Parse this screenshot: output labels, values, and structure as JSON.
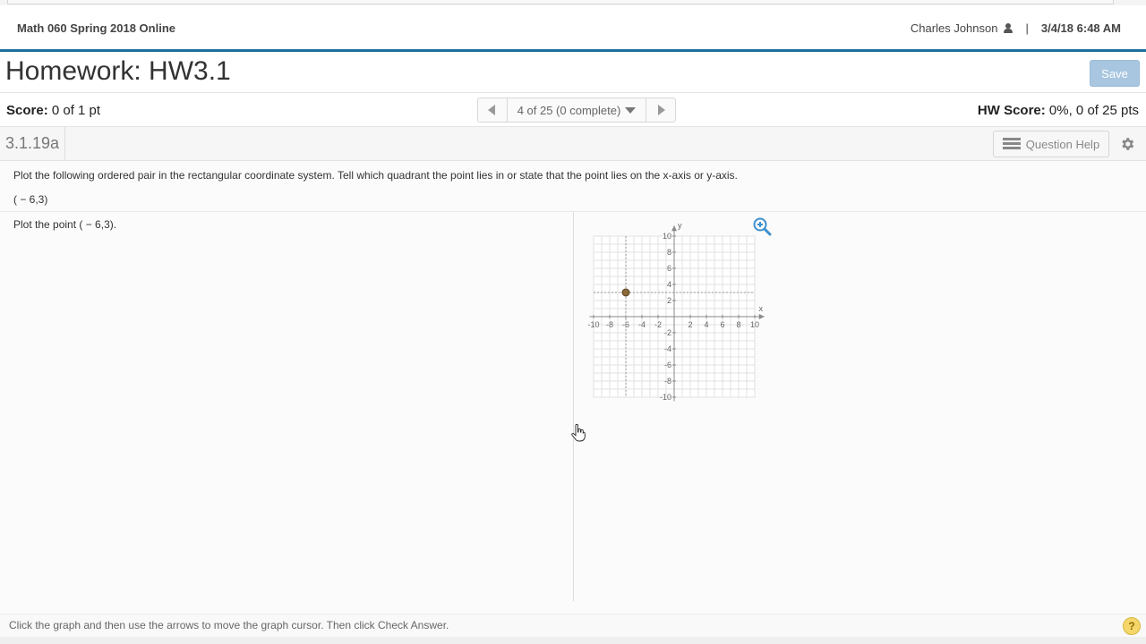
{
  "header": {
    "course": "Math 060 Spring 2018 Online",
    "user_name": "Charles Johnson",
    "separator": "|",
    "datetime": "3/4/18 6:48 AM"
  },
  "title": {
    "text": "Homework: HW3.1",
    "save_label": "Save"
  },
  "score": {
    "label": "Score:",
    "value": "0 of 1 pt",
    "hw_label": "HW Score:",
    "hw_value": "0%, 0 of 25 pts"
  },
  "nav": {
    "position": "4 of 25 (0 complete)"
  },
  "question": {
    "id": "3.1.19a",
    "help_label": "Question Help",
    "text": "Plot the following ordered pair in the rectangular coordinate system. Tell which quadrant the point lies in or state that the point lies on the x-axis or y-axis.",
    "pair": "( − 6,3)",
    "plot_instruction": "Plot the point ( − 6,3)."
  },
  "graph": {
    "x_label": "x",
    "y_label": "y",
    "x_ticks": [
      "-10",
      "-8",
      "-6",
      "-4",
      "-2",
      "2",
      "4",
      "6",
      "8",
      "10"
    ],
    "y_ticks_pos": [
      "10",
      "8",
      "6",
      "4",
      "2"
    ],
    "y_ticks_neg": [
      "-2",
      "-4",
      "-6",
      "-8",
      "-10"
    ],
    "point": {
      "x": -6,
      "y": 3
    },
    "point_color": "#8a6a3a"
  },
  "footer": {
    "hint": "Click the graph and then use the arrows to move the graph cursor. Then click Check Answer.",
    "help": "?"
  },
  "colors": {
    "accent": "#1f6f9e",
    "save_button": "#a8c6e0"
  }
}
